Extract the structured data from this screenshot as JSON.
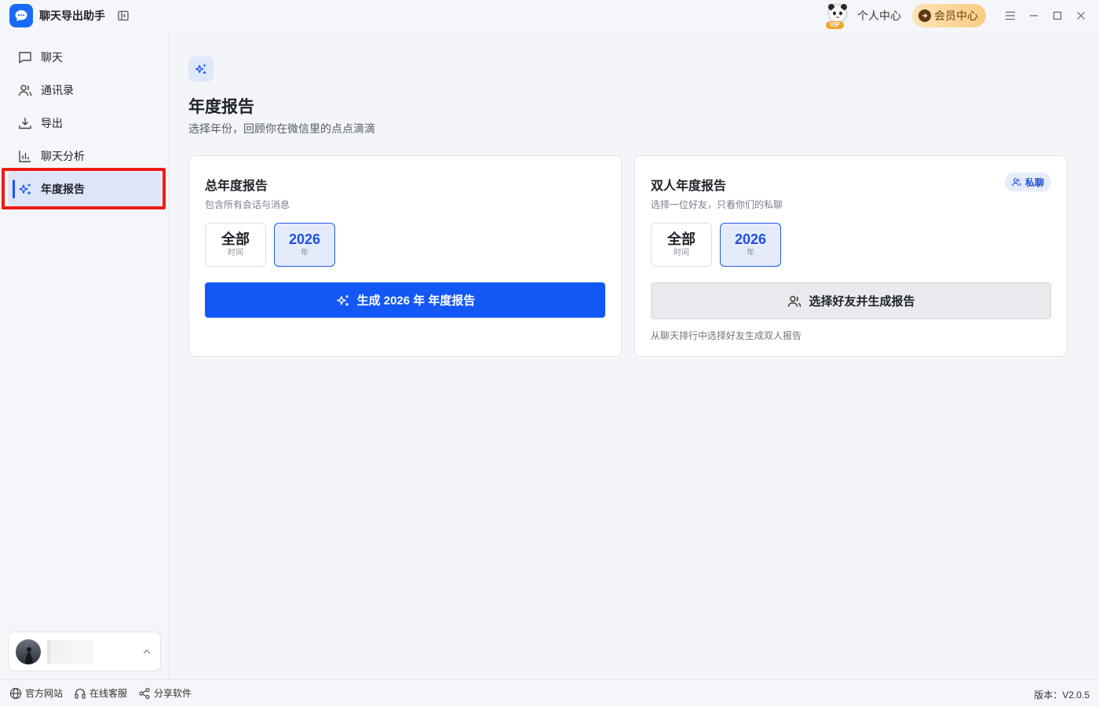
{
  "app": {
    "title": "聊天导出助手"
  },
  "titlebar": {
    "personal_center": "个人中心",
    "member_center": "会员中心",
    "vip_tag": "VIP"
  },
  "sidebar": {
    "items": [
      {
        "label": "聊天",
        "icon": "chat-bubble-icon"
      },
      {
        "label": "通讯录",
        "icon": "contacts-icon"
      },
      {
        "label": "导出",
        "icon": "download-icon"
      },
      {
        "label": "聊天分析",
        "icon": "bar-chart-icon"
      },
      {
        "label": "年度报告",
        "icon": "sparkles-icon",
        "active": true
      }
    ]
  },
  "main": {
    "title": "年度报告",
    "subtitle": "选择年份，回顾你在微信里的点点滴滴",
    "cards": [
      {
        "title": "总年度报告",
        "desc": "包含所有会话与消息",
        "options": [
          {
            "big": "全部",
            "small": "时间",
            "selected": false
          },
          {
            "big": "2026",
            "small": "年",
            "selected": true
          }
        ],
        "button": "生成 2026 年 年度报告"
      },
      {
        "title": "双人年度报告",
        "desc": "选择一位好友，只看你们的私聊",
        "badge": "私聊",
        "options": [
          {
            "big": "全部",
            "small": "时间",
            "selected": false
          },
          {
            "big": "2026",
            "small": "年",
            "selected": true
          }
        ],
        "button": "选择好友并生成报告",
        "hint": "从聊天排行中选择好友生成双人报告"
      }
    ]
  },
  "footer": {
    "links": [
      "官方网站",
      "在线客服",
      "分享软件"
    ],
    "version": "版本：V2.0.5"
  },
  "colors": {
    "accent": "#1357f5",
    "highlight": "#ef1b14",
    "member_gold": "#f9cc83"
  }
}
